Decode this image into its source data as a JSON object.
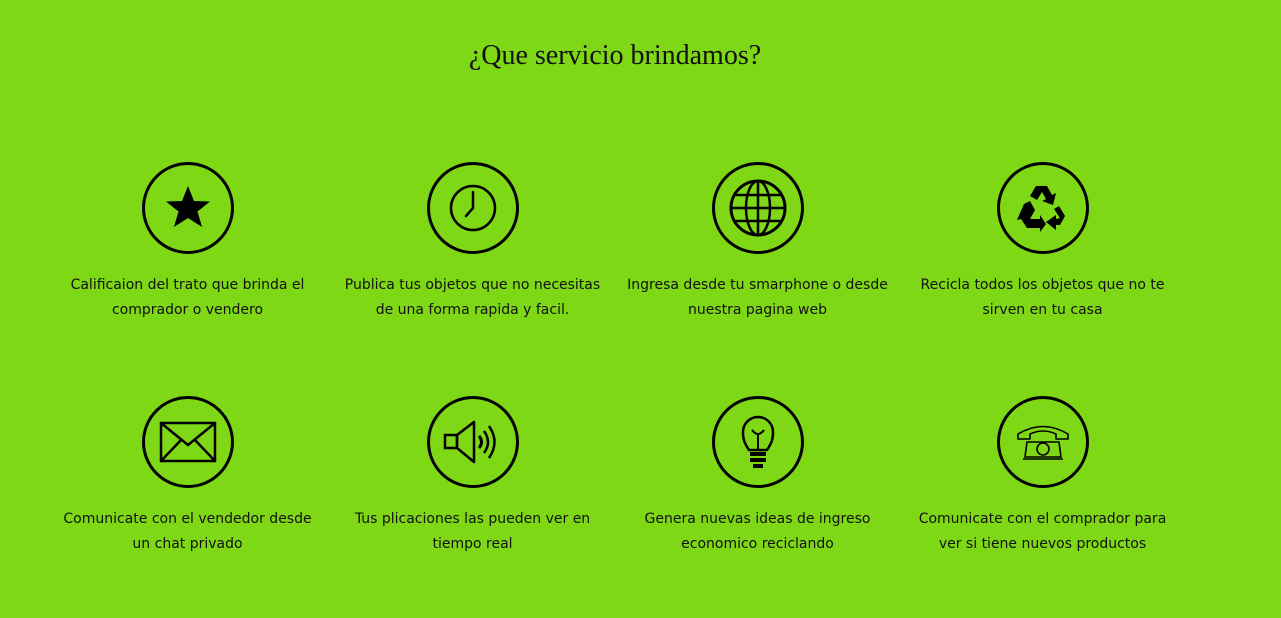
{
  "section": {
    "title": "¿Que servicio brindamos?"
  },
  "colors": {
    "background": "#7ed815",
    "icon": "#000000",
    "text": "#111111"
  },
  "services": [
    {
      "icon": "star-icon",
      "text": "Calificaion del trato que brinda el comprador o vendero"
    },
    {
      "icon": "clock-icon",
      "text": "Publica tus objetos que no necesitas de una forma rapida y facil."
    },
    {
      "icon": "globe-icon",
      "text": "Ingresa desde tu smarphone o desde nuestra pagina web"
    },
    {
      "icon": "recycle-icon",
      "text": "Recicla todos los objetos que no te sirven en tu casa"
    },
    {
      "icon": "envelope-icon",
      "text": "Comunicate con el vendedor desde un chat privado"
    },
    {
      "icon": "megaphone-icon",
      "text": "Tus plicaciones las pueden ver en tiempo real"
    },
    {
      "icon": "lightbulb-icon",
      "text": "Genera nuevas ideas de ingreso economico reciclando"
    },
    {
      "icon": "telephone-icon",
      "text": "Comunicate con el comprador para ver si tiene nuevos productos"
    }
  ]
}
